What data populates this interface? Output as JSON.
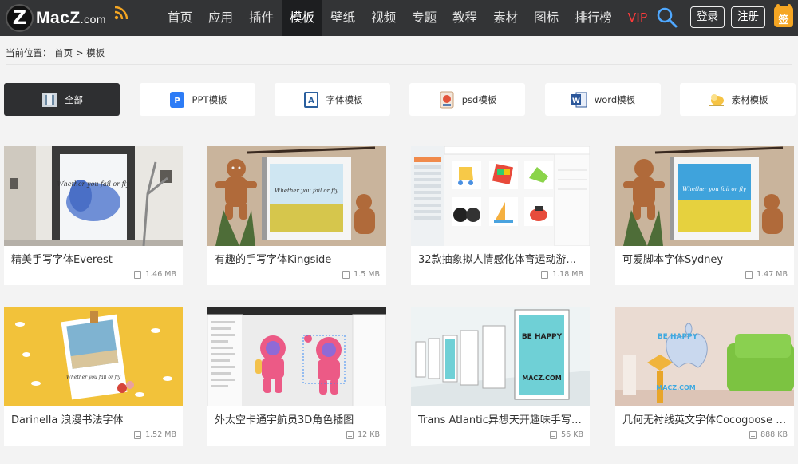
{
  "header": {
    "logo_letter": "Z",
    "logo_text_main": "Mac",
    "logo_text_z": "Z",
    "logo_text_suffix": ".com",
    "nav": [
      "首页",
      "应用",
      "插件",
      "模板",
      "壁纸",
      "视频",
      "专题",
      "教程",
      "素材",
      "图标",
      "排行榜",
      "VIP"
    ],
    "active_nav": "模板",
    "login": "登录",
    "register": "注册",
    "signin_badge": "签"
  },
  "breadcrumb": {
    "label": "当前位置：",
    "home": "首页",
    "separator": ">",
    "current": "模板"
  },
  "categories": [
    {
      "label": "全部",
      "icon": "all-templates-icon",
      "active": true
    },
    {
      "label": "PPT模板",
      "icon": "ppt-icon",
      "active": false
    },
    {
      "label": "字体模板",
      "icon": "font-icon",
      "active": false
    },
    {
      "label": "psd模板",
      "icon": "psd-icon",
      "active": false
    },
    {
      "label": "word模板",
      "icon": "word-icon",
      "active": false
    },
    {
      "label": "素材模板",
      "icon": "material-icon",
      "active": false
    }
  ],
  "cards": [
    {
      "title": "精美手写字体Everest",
      "size": "1.46 MB"
    },
    {
      "title": "有趣的手写字体Kingside",
      "size": "1.5 MB"
    },
    {
      "title": "32款抽象拟人情感化体育运动游...",
      "size": "1.18 MB"
    },
    {
      "title": "可爱脚本字体Sydney",
      "size": "1.47 MB"
    },
    {
      "title": "Darinella 浪漫书法字体",
      "size": "1.52 MB"
    },
    {
      "title": "外太空卡通宇航员3D角色插图",
      "size": "12 KB"
    },
    {
      "title": "Trans Atlantic异想天开趣味手写字...",
      "size": "56 KB"
    },
    {
      "title": "几何无衬线英文字体Cocogoose Pr...",
      "size": "888 KB"
    }
  ],
  "thumb_text": {
    "card1": "Whether you fail or fly",
    "card2": "Whether you fail or fly",
    "card4": "Whether you fail or fly",
    "card5": "Whether you fail or fly",
    "card7_a": "BE HAPPY",
    "card7_b": "MACZ.COM",
    "card8_a": "BE HAPPY",
    "card8_b": "MACZ.COM"
  },
  "colors": {
    "header_bg": "#333436",
    "active_tab_bg": "#2e2f31",
    "vip": "#ff3b3b",
    "signin": "#f5a623"
  }
}
